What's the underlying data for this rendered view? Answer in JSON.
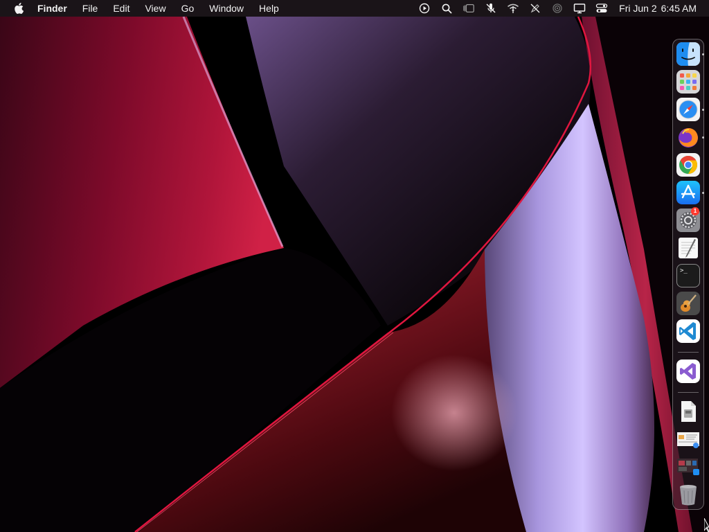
{
  "menubar": {
    "app_name": "Finder",
    "menus": [
      "File",
      "Edit",
      "View",
      "Go",
      "Window",
      "Help"
    ],
    "status_icons": [
      "play-icon",
      "search-icon",
      "stage-manager-icon",
      "mute-icon",
      "wifi-icon",
      "pen-off-icon",
      "airdrop-icon",
      "display-icon",
      "control-center-icon"
    ],
    "clock": {
      "date": "Fri Jun 2",
      "time": "6:45 AM"
    }
  },
  "dock": {
    "apps": [
      {
        "name": "Finder",
        "icon": "finder-icon",
        "running": true
      },
      {
        "name": "Launchpad",
        "icon": "launchpad-icon",
        "running": false
      },
      {
        "name": "Safari",
        "icon": "safari-icon",
        "running": true
      },
      {
        "name": "Firefox",
        "icon": "firefox-icon",
        "running": true
      },
      {
        "name": "Google Chrome",
        "icon": "chrome-icon",
        "running": true
      },
      {
        "name": "App Store",
        "icon": "app-store-icon",
        "running": true
      },
      {
        "name": "System Settings",
        "icon": "system-settings-icon",
        "running": false,
        "badge": "1"
      },
      {
        "name": "TextEdit",
        "icon": "textedit-icon",
        "running": false
      },
      {
        "name": "Terminal",
        "icon": "terminal-icon",
        "running": false
      },
      {
        "name": "GarageBand",
        "icon": "garageband-icon",
        "running": false
      },
      {
        "name": "Visual Studio Code",
        "icon": "vscode-icon",
        "running": false
      }
    ],
    "recent": [
      {
        "name": "Visual Studio",
        "icon": "visual-studio-icon"
      }
    ],
    "stacks": [
      {
        "name": "Document",
        "icon": "document-icon"
      },
      {
        "name": "Screenshots",
        "icon": "screenshot-stack-icon"
      },
      {
        "name": "Applications",
        "icon": "applications-stack-icon"
      }
    ],
    "trash": {
      "name": "Trash",
      "icon": "trash-icon"
    },
    "terminal_glyph": ">_"
  },
  "colors": {
    "menubar_bg": "#1c161a",
    "accent_red": "#c4143a",
    "accent_lilac": "#c8b4ff",
    "badge_red": "#ff3b30"
  }
}
